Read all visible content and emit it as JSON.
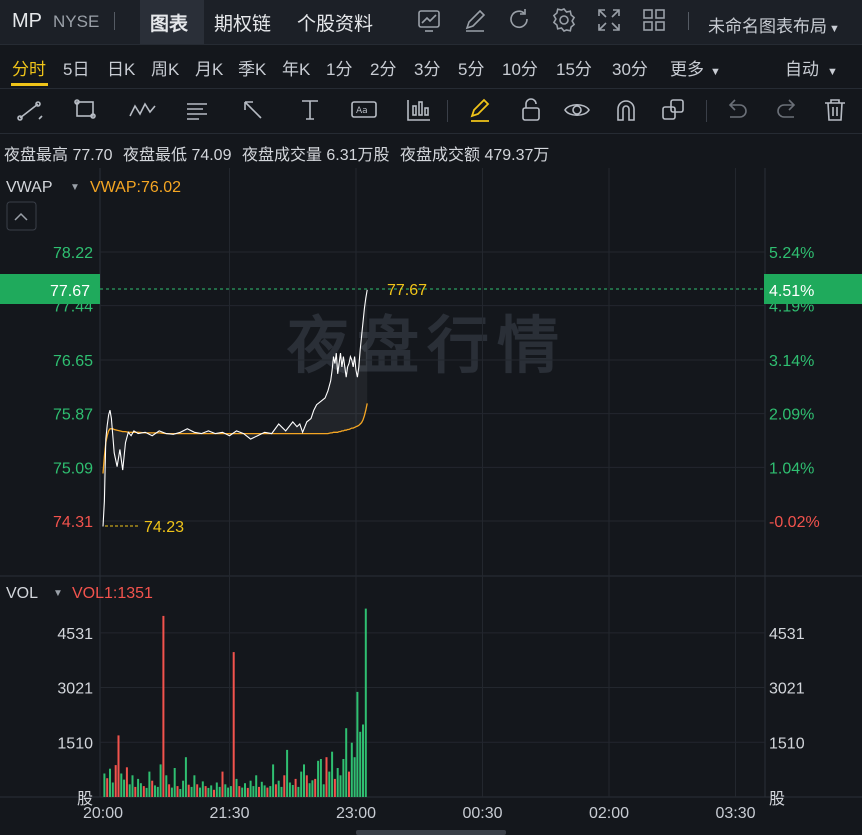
{
  "header": {
    "symbol": "MP",
    "exchange": "NYSE",
    "tabs": [
      "图表",
      "期权链",
      "个股资料"
    ],
    "layout_name": "未命名图表布局",
    "icons": [
      "chart-add-icon",
      "pen-icon",
      "refresh-icon",
      "gear-icon",
      "fullscreen-icon",
      "grid-icon"
    ]
  },
  "periods": {
    "items": [
      "分时",
      "5日",
      "日K",
      "周K",
      "月K",
      "季K",
      "年K",
      "1分",
      "2分",
      "3分",
      "5分",
      "10分",
      "15分",
      "30分",
      "更多"
    ],
    "active": "分时",
    "auto_label": "自动"
  },
  "toolbar": {
    "icons": [
      "line-tool-icon",
      "rect-tool-icon",
      "wave-tool-icon",
      "fib-tool-icon",
      "arrow-tool-icon",
      "text-tool-icon",
      "label-tool-icon",
      "candle-tool-icon",
      "highlighter-icon",
      "lock-icon",
      "eye-icon",
      "magnet-icon",
      "layers-icon",
      "undo-icon",
      "redo-icon",
      "trash-icon"
    ]
  },
  "stats": {
    "high_label": "夜盘最高",
    "high": "77.70",
    "low_label": "夜盘最低",
    "low": "74.09",
    "vol_label": "夜盘成交量",
    "vol": "6.31万股",
    "amt_label": "夜盘成交额",
    "amt": "479.37万"
  },
  "watermark": "夜盘行情",
  "colors": {
    "up": "#2fbf71",
    "down": "#f2534d",
    "price_line": "#ffffff",
    "vwap_line": "#f5a623",
    "label_yellow": "#f0c419",
    "current_bg": "#1faa5c"
  },
  "chart_data": [
    {
      "type": "line",
      "indicator_label": "VWAP",
      "indicator_value": "VWAP:76.02",
      "y_ticks_left": [
        "78.22",
        "77.44",
        "76.65",
        "75.87",
        "75.09",
        "74.31"
      ],
      "y_ticks_right": [
        "5.24%",
        "4.19%",
        "3.14%",
        "2.09%",
        "1.04%",
        "-0.02%"
      ],
      "x_ticks": [
        "20:00",
        "21:30",
        "23:00",
        "00:30",
        "02:00",
        "03:30"
      ],
      "current_price": "77.67",
      "current_pct": "4.51%",
      "low_marker": "74.23",
      "ylim": [
        74.31,
        78.22
      ],
      "x_minutes": [
        0,
        1,
        2,
        3,
        4,
        5,
        6,
        7,
        8,
        10,
        12,
        14,
        16,
        18,
        20,
        22,
        25,
        30,
        35,
        40,
        45,
        50,
        55,
        60,
        65,
        70,
        75,
        80,
        85,
        90,
        95,
        100,
        105,
        110,
        115,
        120,
        125,
        130,
        135,
        138,
        140,
        142,
        145,
        148,
        150,
        152,
        155,
        158,
        160,
        162,
        163,
        164,
        165,
        166,
        167,
        168,
        169,
        170,
        171,
        172,
        173,
        174,
        175,
        176,
        177,
        178,
        179,
        180,
        181,
        182,
        183,
        184,
        185,
        186,
        187,
        188
      ],
      "series": [
        {
          "name": "Price",
          "values": [
            74.23,
            74.6,
            75.5,
            75.7,
            75.85,
            75.92,
            75.8,
            75.55,
            75.3,
            75.1,
            75.35,
            75.05,
            75.45,
            75.6,
            75.55,
            75.62,
            75.58,
            75.6,
            75.55,
            75.62,
            75.58,
            75.57,
            75.6,
            75.65,
            75.6,
            75.58,
            75.62,
            75.58,
            75.6,
            75.55,
            75.62,
            75.58,
            75.5,
            75.55,
            75.6,
            75.58,
            75.72,
            75.62,
            75.75,
            75.68,
            75.72,
            75.6,
            75.75,
            75.8,
            75.92,
            76.0,
            76.05,
            76.1,
            76.2,
            76.35,
            76.5,
            76.7,
            76.6,
            76.75,
            76.45,
            76.6,
            76.75,
            76.55,
            76.7,
            76.55,
            76.4,
            76.55,
            76.6,
            76.7,
            76.65,
            76.55,
            76.7,
            76.5,
            76.4,
            76.55,
            76.8,
            77.0,
            77.2,
            77.4,
            77.55,
            77.67
          ]
        },
        {
          "name": "VWAP",
          "values": [
            75.0,
            75.25,
            75.45,
            75.55,
            75.62,
            75.65,
            75.65,
            75.65,
            75.64,
            75.63,
            75.62,
            75.61,
            75.61,
            75.6,
            75.6,
            75.6,
            75.6,
            75.59,
            75.59,
            75.59,
            75.58,
            75.58,
            75.58,
            75.58,
            75.58,
            75.58,
            75.58,
            75.58,
            75.58,
            75.58,
            75.58,
            75.58,
            75.58,
            75.58,
            75.58,
            75.58,
            75.58,
            75.58,
            75.58,
            75.58,
            75.58,
            75.58,
            75.58,
            75.58,
            75.58,
            75.58,
            75.58,
            75.58,
            75.58,
            75.59,
            75.59,
            75.6,
            75.6,
            75.6,
            75.6,
            75.61,
            75.61,
            75.62,
            75.62,
            75.63,
            75.63,
            75.64,
            75.64,
            75.65,
            75.66,
            75.66,
            75.67,
            75.68,
            75.69,
            75.7,
            75.72,
            75.74,
            75.78,
            75.84,
            75.92,
            76.02
          ]
        }
      ]
    },
    {
      "type": "bar",
      "indicator_label": "VOL",
      "indicator_value": "VOL1:1351",
      "y_ticks": [
        "4531",
        "3021",
        "1510",
        "股"
      ],
      "unit": "股",
      "ylim": [
        0,
        5300
      ],
      "x_minutes": [
        1,
        3,
        5,
        7,
        9,
        11,
        13,
        15,
        17,
        19,
        21,
        23,
        25,
        27,
        29,
        31,
        33,
        35,
        37,
        39,
        41,
        43,
        45,
        47,
        49,
        51,
        53,
        55,
        57,
        59,
        61,
        63,
        65,
        67,
        69,
        71,
        73,
        75,
        77,
        79,
        81,
        83,
        85,
        87,
        89,
        91,
        93,
        95,
        97,
        99,
        101,
        103,
        105,
        107,
        109,
        111,
        113,
        115,
        117,
        119,
        121,
        123,
        125,
        127,
        129,
        131,
        133,
        135,
        137,
        139,
        141,
        143,
        145,
        147,
        149,
        151,
        153,
        155,
        157,
        159,
        161,
        163,
        165,
        167,
        169,
        171,
        173,
        175,
        177,
        179,
        181,
        183,
        185,
        187
      ],
      "values": [
        650,
        520,
        780,
        400,
        880,
        1700,
        650,
        480,
        820,
        350,
        600,
        280,
        500,
        380,
        300,
        250,
        700,
        450,
        320,
        280,
        900,
        5000,
        600,
        350,
        260,
        800,
        300,
        220,
        450,
        1100,
        340,
        280,
        600,
        350,
        260,
        430,
        300,
        250,
        320,
        200,
        400,
        280,
        700,
        350,
        260,
        300,
        4000,
        500,
        300,
        260,
        380,
        250,
        450,
        300,
        600,
        280,
        420,
        320,
        260,
        300,
        900,
        350,
        450,
        280,
        600,
        1300,
        400,
        330,
        500,
        280,
        700,
        900,
        600,
        380,
        460,
        500,
        1000,
        1050,
        350,
        1100,
        700,
        1250,
        500,
        800,
        600,
        1050,
        1900,
        700,
        1500,
        1100,
        2900,
        1800,
        2000,
        5200
      ],
      "colors": [
        "up",
        "down",
        "up",
        "up",
        "down",
        "down",
        "up",
        "up",
        "down",
        "up",
        "up",
        "down",
        "up",
        "up",
        "down",
        "up",
        "up",
        "down",
        "up",
        "up",
        "up",
        "down",
        "up",
        "down",
        "up",
        "up",
        "down",
        "up",
        "up",
        "up",
        "down",
        "up",
        "up",
        "down",
        "up",
        "up",
        "down",
        "up",
        "up",
        "down",
        "up",
        "up",
        "down",
        "up",
        "up",
        "up",
        "down",
        "up",
        "down",
        "up",
        "up",
        "down",
        "up",
        "up",
        "up",
        "down",
        "up",
        "up",
        "down",
        "up",
        "up",
        "down",
        "up",
        "up",
        "down",
        "up",
        "up",
        "up",
        "down",
        "up",
        "up",
        "up",
        "down",
        "up",
        "up",
        "down",
        "up",
        "up",
        "up",
        "down",
        "up",
        "up",
        "down",
        "up",
        "up",
        "up",
        "up",
        "down",
        "up",
        "up",
        "up",
        "up",
        "up",
        "up"
      ]
    }
  ]
}
